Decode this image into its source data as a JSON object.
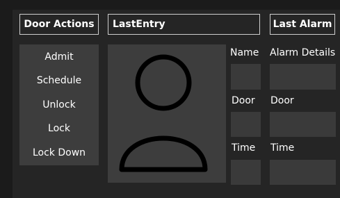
{
  "headers": {
    "door_actions": "Door Actions",
    "last_entry": "LastEntry",
    "last_alarm": "Last Alarm"
  },
  "actions": [
    "Admit",
    "Schedule",
    "Unlock",
    "Lock",
    "Lock Down"
  ],
  "entry": {
    "name_label": "Name",
    "door_label": "Door",
    "time_label": "Time",
    "name_value": "",
    "door_value": "",
    "time_value": ""
  },
  "alarm": {
    "details_label": "Alarm Details",
    "door_label": "Door",
    "time_label": "Time",
    "details_value": "",
    "door_value": "",
    "time_value": ""
  },
  "icons": {
    "photo_placeholder": "user-silhouette-icon"
  },
  "colors": {
    "background": "#1b1b1b",
    "panel": "#252525",
    "control": "#3d3d3d",
    "text": "#ffffff",
    "header_border": "#cfcfcf"
  }
}
